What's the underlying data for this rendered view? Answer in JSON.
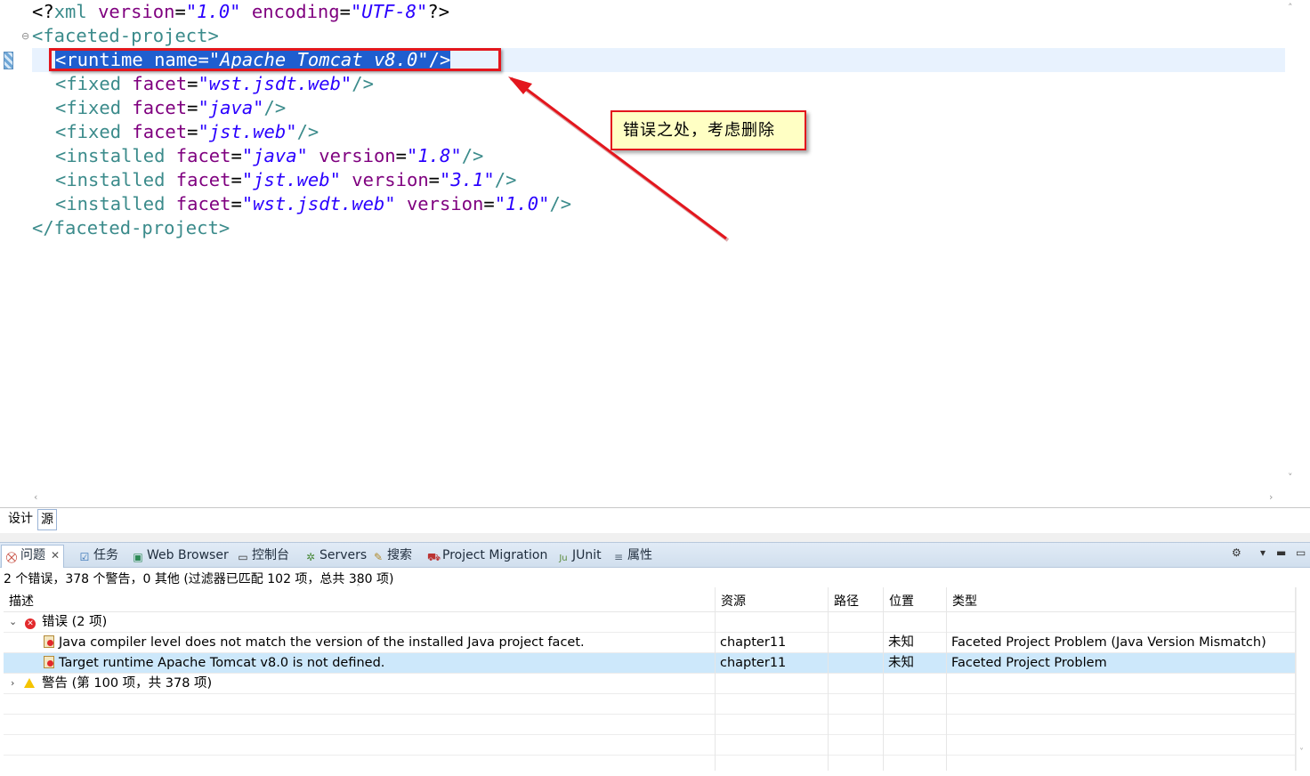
{
  "editor": {
    "lines": [
      {
        "parts": [
          [
            "punct",
            "<?"
          ],
          [
            "tag",
            "xml"
          ],
          [
            "punct",
            " "
          ],
          [
            "attr",
            "version"
          ],
          [
            "punct",
            "="
          ],
          [
            "val",
            "\"1.0\""
          ],
          [
            "punct",
            " "
          ],
          [
            "attr",
            "encoding"
          ],
          [
            "punct",
            "="
          ],
          [
            "val",
            "\"UTF-8\""
          ],
          [
            "punct",
            "?>"
          ]
        ]
      },
      {
        "parts": [
          [
            "tag",
            "<faceted-project"
          ],
          [
            "tag",
            ">"
          ]
        ]
      },
      {
        "parts": [
          [
            "tag",
            "<runtime"
          ],
          [
            "punct",
            " "
          ],
          [
            "attr",
            "name"
          ],
          [
            "punct",
            "="
          ],
          [
            "val",
            "\"Apache Tomcat v8.0\""
          ],
          [
            "tag",
            "/>"
          ]
        ],
        "selected": true
      },
      {
        "parts": [
          [
            "tag",
            "<fixed"
          ],
          [
            "punct",
            " "
          ],
          [
            "attr",
            "facet"
          ],
          [
            "punct",
            "="
          ],
          [
            "val",
            "\"wst.jsdt.web\""
          ],
          [
            "tag",
            "/>"
          ]
        ]
      },
      {
        "parts": [
          [
            "tag",
            "<fixed"
          ],
          [
            "punct",
            " "
          ],
          [
            "attr",
            "facet"
          ],
          [
            "punct",
            "="
          ],
          [
            "val",
            "\"java\""
          ],
          [
            "tag",
            "/>"
          ]
        ]
      },
      {
        "parts": [
          [
            "tag",
            "<fixed"
          ],
          [
            "punct",
            " "
          ],
          [
            "attr",
            "facet"
          ],
          [
            "punct",
            "="
          ],
          [
            "val",
            "\"jst.web\""
          ],
          [
            "tag",
            "/>"
          ]
        ]
      },
      {
        "parts": [
          [
            "tag",
            "<installed"
          ],
          [
            "punct",
            " "
          ],
          [
            "attr",
            "facet"
          ],
          [
            "punct",
            "="
          ],
          [
            "val",
            "\"java\""
          ],
          [
            "punct",
            " "
          ],
          [
            "attr",
            "version"
          ],
          [
            "punct",
            "="
          ],
          [
            "val",
            "\"1.8\""
          ],
          [
            "tag",
            "/>"
          ]
        ]
      },
      {
        "parts": [
          [
            "tag",
            "<installed"
          ],
          [
            "punct",
            " "
          ],
          [
            "attr",
            "facet"
          ],
          [
            "punct",
            "="
          ],
          [
            "val",
            "\"jst.web\""
          ],
          [
            "punct",
            " "
          ],
          [
            "attr",
            "version"
          ],
          [
            "punct",
            "="
          ],
          [
            "val",
            "\"3.1\""
          ],
          [
            "tag",
            "/>"
          ]
        ]
      },
      {
        "parts": [
          [
            "tag",
            "<installed"
          ],
          [
            "punct",
            " "
          ],
          [
            "attr",
            "facet"
          ],
          [
            "punct",
            "="
          ],
          [
            "val",
            "\"wst.jsdt.web\""
          ],
          [
            "punct",
            " "
          ],
          [
            "attr",
            "version"
          ],
          [
            "punct",
            "="
          ],
          [
            "val",
            "\"1.0\""
          ],
          [
            "tag",
            "/>"
          ]
        ]
      },
      {
        "parts": [
          [
            "tag",
            "</faceted-project"
          ],
          [
            "tag",
            ">"
          ]
        ]
      }
    ],
    "fold_icon": "⊖",
    "callout": "错误之处，考虑删除"
  },
  "mode_tabs": {
    "design": "设计",
    "source": "源"
  },
  "views": {
    "tabs": [
      {
        "icon": "problems-icon",
        "label": "问题",
        "close": "✕"
      },
      {
        "icon": "tasks-icon",
        "label": "任务"
      },
      {
        "icon": "web-browser-icon",
        "label": "Web Browser"
      },
      {
        "icon": "console-icon",
        "label": "控制台"
      },
      {
        "icon": "servers-icon",
        "label": "Servers"
      },
      {
        "icon": "search-icon",
        "label": "搜索"
      },
      {
        "icon": "project-migration-icon",
        "label": "Project Migration"
      },
      {
        "icon": "junit-icon",
        "label": "JUnit"
      },
      {
        "icon": "properties-icon",
        "label": "属性"
      }
    ]
  },
  "problems": {
    "summary": "2 个错误，378 个警告，0 其他 (过滤器已匹配 102 项，总共 380 项)",
    "columns": [
      "描述",
      "资源",
      "路径",
      "位置",
      "类型"
    ],
    "error_group": "错误 (2 项)",
    "errors": [
      {
        "description": "Java compiler level does not match the version of the installed Java project facet.",
        "resource": "chapter11",
        "path": "",
        "location": "未知",
        "type": "Faceted Project Problem (Java Version Mismatch)"
      },
      {
        "description": "Target runtime Apache Tomcat v8.0 is not defined.",
        "resource": "chapter11",
        "path": "",
        "location": "未知",
        "type": "Faceted Project Problem"
      }
    ],
    "warning_group": "警告 (第 100 项，共 378 项)"
  },
  "colors": {
    "selection": "#1f5ecf",
    "annotation_red": "#e3161d",
    "callout_bg": "#ffffc4",
    "row_selected": "#cde8fb"
  }
}
